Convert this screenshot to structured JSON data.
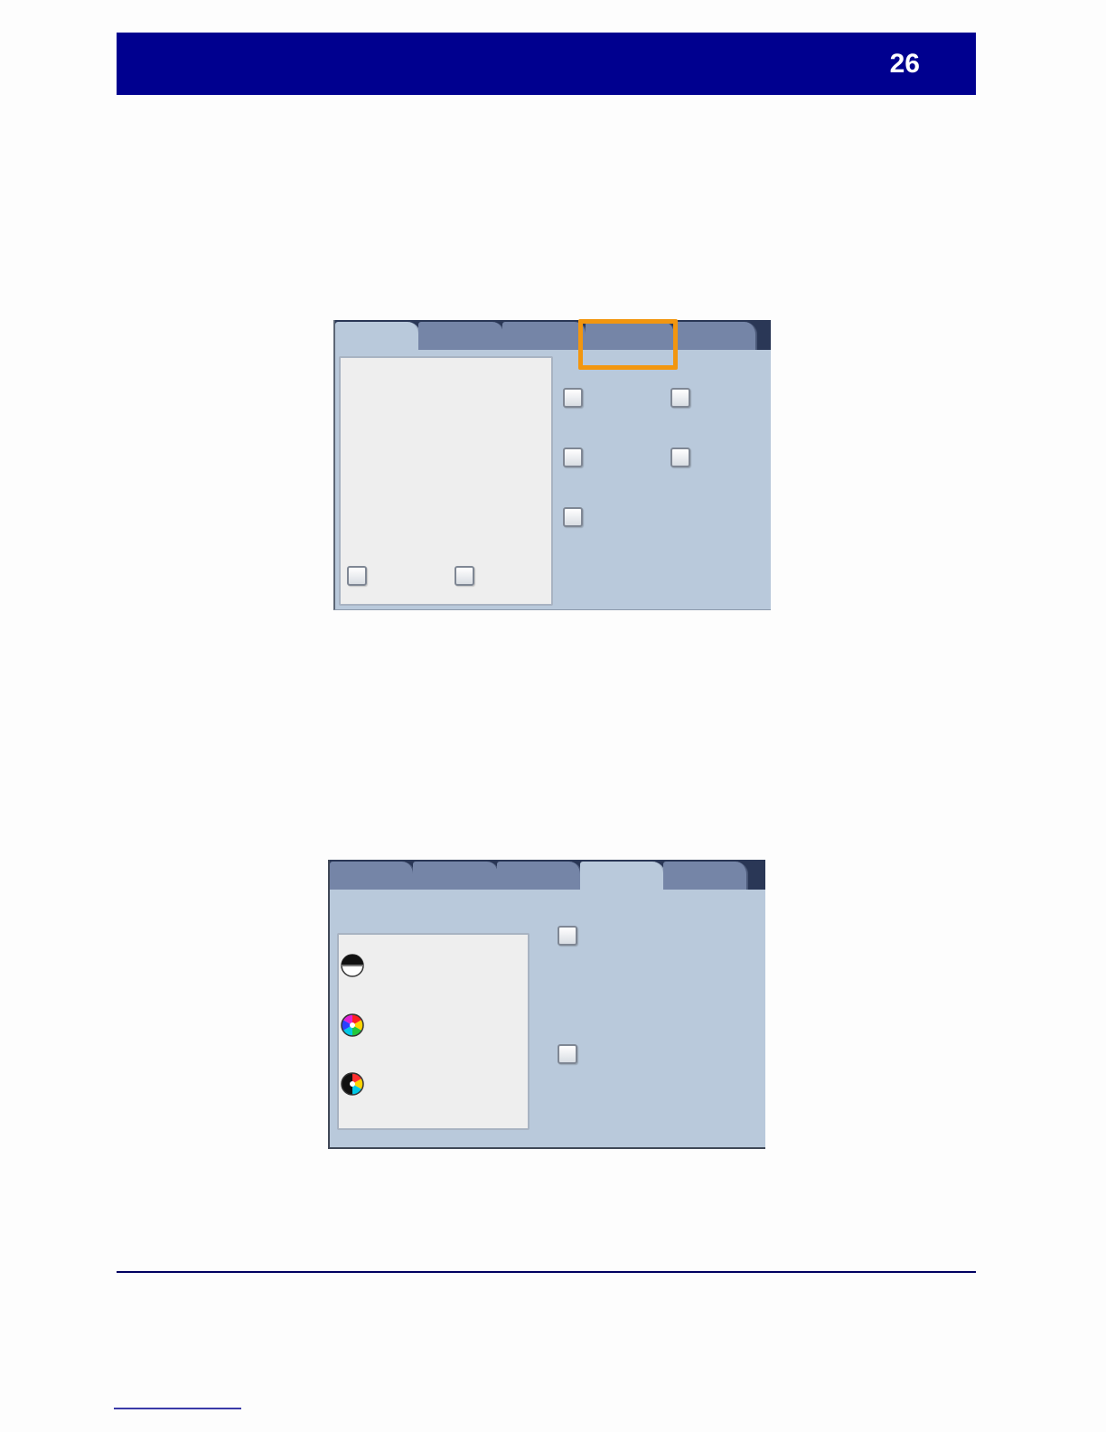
{
  "header": {
    "page_number": "26"
  },
  "colors": {
    "header_band": "#00008f",
    "callout": "#f2960f"
  },
  "screen_a": {
    "tabs": [
      "",
      "",
      "",
      "",
      ""
    ],
    "active_tab": 0,
    "highlighted_tab": 3,
    "checkbox_count": 7
  },
  "screen_b": {
    "tabs": [
      "",
      "",
      "",
      "",
      ""
    ],
    "active_tab": 3,
    "output_color_icons": [
      "black-and-white-icon",
      "color-wheel-icon",
      "dual-color-icon"
    ],
    "checkbox_count": 2
  }
}
